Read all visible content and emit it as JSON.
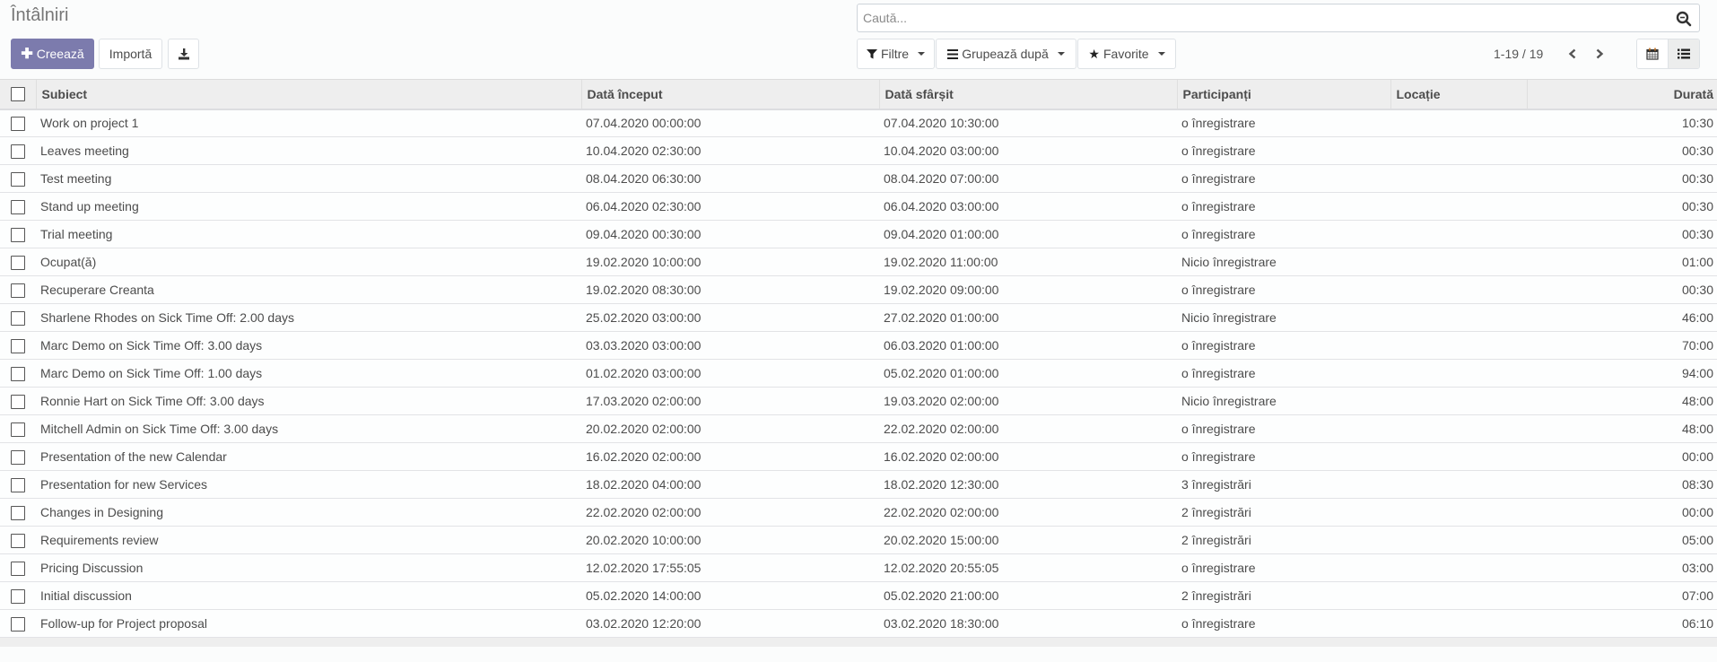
{
  "header": {
    "title": "Întâlniri"
  },
  "toolbar": {
    "create_label": "Creează",
    "import_label": "Importă",
    "download_icon": "download-icon"
  },
  "search": {
    "placeholder": "Caută...",
    "value": ""
  },
  "filters": {
    "filters_label": "Filtre",
    "groupby_label": "Grupează după",
    "favorites_label": "Favorite"
  },
  "pager": {
    "value": "1-19 / 19"
  },
  "views": {
    "items": [
      {
        "name": "calendar",
        "icon": "calendar-icon",
        "active": false
      },
      {
        "name": "list",
        "icon": "list-icon",
        "active": true
      }
    ]
  },
  "colors": {
    "primary": "#7c7bad",
    "header_bg": "#eeeeee"
  },
  "table": {
    "columns": [
      "Subiect",
      "Dată început",
      "Dată sfârșit",
      "Participanți",
      "Locație",
      "Durată"
    ],
    "rows": [
      [
        "Work on project 1",
        "07.04.2020 00:00:00",
        "07.04.2020 10:30:00",
        "o înregistrare",
        "",
        "10:30"
      ],
      [
        "Leaves meeting",
        "10.04.2020 02:30:00",
        "10.04.2020 03:00:00",
        "o înregistrare",
        "",
        "00:30"
      ],
      [
        "Test meeting",
        "08.04.2020 06:30:00",
        "08.04.2020 07:00:00",
        "o înregistrare",
        "",
        "00:30"
      ],
      [
        "Stand up meeting",
        "06.04.2020 02:30:00",
        "06.04.2020 03:00:00",
        "o înregistrare",
        "",
        "00:30"
      ],
      [
        "Trial meeting",
        "09.04.2020 00:30:00",
        "09.04.2020 01:00:00",
        "o înregistrare",
        "",
        "00:30"
      ],
      [
        "Ocupat(ă)",
        "19.02.2020 10:00:00",
        "19.02.2020 11:00:00",
        "Nicio înregistrare",
        "",
        "01:00"
      ],
      [
        "Recuperare Creanta",
        "19.02.2020 08:30:00",
        "19.02.2020 09:00:00",
        "o înregistrare",
        "",
        "00:30"
      ],
      [
        "Sharlene Rhodes on Sick Time Off: 2.00 days",
        "25.02.2020 03:00:00",
        "27.02.2020 01:00:00",
        "Nicio înregistrare",
        "",
        "46:00"
      ],
      [
        "Marc Demo on Sick Time Off: 3.00 days",
        "03.03.2020 03:00:00",
        "06.03.2020 01:00:00",
        "o înregistrare",
        "",
        "70:00"
      ],
      [
        "Marc Demo on Sick Time Off: 1.00 days",
        "01.02.2020 03:00:00",
        "05.02.2020 01:00:00",
        "o înregistrare",
        "",
        "94:00"
      ],
      [
        "Ronnie Hart on Sick Time Off: 3.00 days",
        "17.03.2020 02:00:00",
        "19.03.2020 02:00:00",
        "Nicio înregistrare",
        "",
        "48:00"
      ],
      [
        "Mitchell Admin on Sick Time Off: 3.00 days",
        "20.02.2020 02:00:00",
        "22.02.2020 02:00:00",
        "o înregistrare",
        "",
        "48:00"
      ],
      [
        "Presentation of the new Calendar",
        "16.02.2020 02:00:00",
        "16.02.2020 02:00:00",
        "o înregistrare",
        "",
        "00:00"
      ],
      [
        "Presentation for new Services",
        "18.02.2020 04:00:00",
        "18.02.2020 12:30:00",
        "3 înregistrări",
        "",
        "08:30"
      ],
      [
        "Changes in Designing",
        "22.02.2020 02:00:00",
        "22.02.2020 02:00:00",
        "2 înregistrări",
        "",
        "00:00"
      ],
      [
        "Requirements review",
        "20.02.2020 10:00:00",
        "20.02.2020 15:00:00",
        "2 înregistrări",
        "",
        "05:00"
      ],
      [
        "Pricing Discussion",
        "12.02.2020 17:55:05",
        "12.02.2020 20:55:05",
        "o înregistrare",
        "",
        "03:00"
      ],
      [
        "Initial discussion",
        "05.02.2020 14:00:00",
        "05.02.2020 21:00:00",
        "2 înregistrări",
        "",
        "07:00"
      ],
      [
        "Follow-up for Project proposal",
        "03.02.2020 12:20:00",
        "03.02.2020 18:30:00",
        "o înregistrare",
        "",
        "06:10"
      ]
    ]
  }
}
